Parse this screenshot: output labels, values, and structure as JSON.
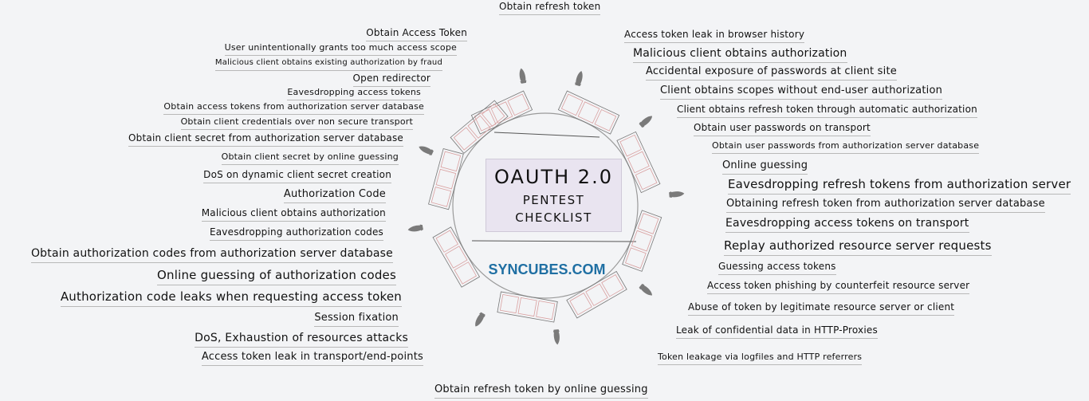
{
  "center": {
    "title": "OAUTH 2.0",
    "subtitle_line1": "PENTEST",
    "subtitle_line2": "CHECKLIST",
    "brand": "SYNCUBES.COM",
    "box_color": "#e9e4f0",
    "brand_color": "#1f6fa3"
  },
  "top_item": "Obtain refresh token",
  "bottom_item": "Obtain refresh token by online guessing",
  "left_items": [
    "Obtain Access Token",
    "User unintentionally grants too much access scope",
    "Malicious client obtains existing authorization by fraud",
    "Open redirector",
    "Eavesdropping access tokens",
    "Obtain access tokens from authorization server database",
    "Obtain client credentials over non secure transport",
    "Obtain client secret from authorization server database",
    "Obtain client secret by online guessing",
    "DoS on dynamic client secret creation",
    "Authorization Code",
    "Malicious client obtains authorization",
    "Eavesdropping authorization codes",
    "Obtain authorization codes from authorization server database",
    "Online guessing of authorization codes",
    "Authorization code leaks when requesting access token",
    "Session fixation",
    "DoS, Exhaustion of resources attacks",
    "Access token leak in transport/end-points"
  ],
  "right_items": [
    "Access token leak in browser history",
    "Malicious client obtains authorization",
    "Accidental exposure of passwords at client site",
    "Client obtains scopes without end-user authorization",
    "Client obtains refresh token through automatic authorization",
    "Obtain user passwords on transport",
    "Obtain user passwords from authorization server database",
    "Online guessing",
    "Eavesdropping refresh tokens from authorization server",
    "Obtaining refresh token from authorization server database",
    "Eavesdropping access tokens on transport",
    "Replay authorized resource server requests",
    "Guessing access tokens",
    "Access token phishing by counterfeit resource server",
    "Abuse of token by legitimate resource server or client",
    "Leak of confidential data in HTTP-Proxies",
    "Token leakage via logfiles and HTTP referrers"
  ]
}
